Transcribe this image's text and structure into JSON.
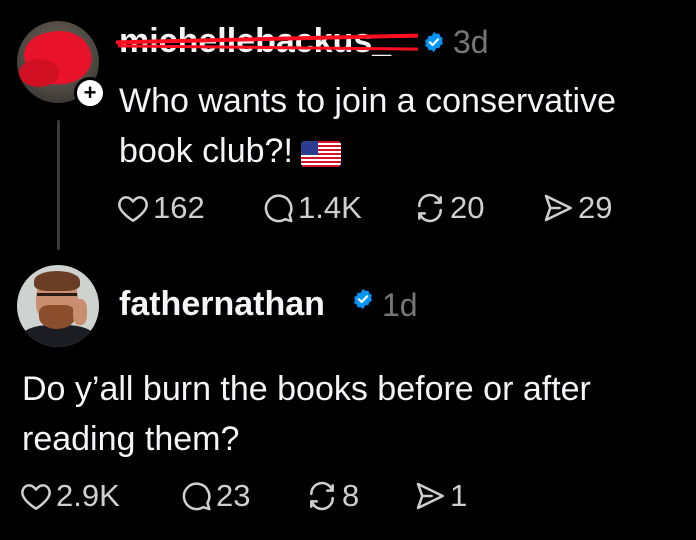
{
  "posts": [
    {
      "username": "michellebackus_",
      "username_redacted": true,
      "time": "3d",
      "verified": true,
      "text": "Who wants to join a conservative",
      "text_line2": "book club?!",
      "emoji": "us-flag",
      "has_follow_badge": true,
      "actions": {
        "likes": "162",
        "replies": "1.4K",
        "reposts": "20",
        "shares": "29"
      }
    },
    {
      "username": "fathernathan",
      "time": "1d",
      "verified": true,
      "text": "Do y’all burn the books before or after",
      "text_line2": "reading them?",
      "actions": {
        "likes": "2.9K",
        "replies": "23",
        "reposts": "8",
        "shares": "1"
      }
    }
  ],
  "icons": {
    "like": "heart-icon",
    "reply": "comment-icon",
    "repost": "repost-icon",
    "share": "share-icon",
    "verified": "verified-badge-icon",
    "follow": "plus-icon"
  },
  "colors": {
    "background": "#000000",
    "text": "#f3f5f7",
    "muted": "#777777",
    "verified": "#0095f6",
    "redaction": "#ff0f1f"
  },
  "follow_badge_symbol": "+"
}
